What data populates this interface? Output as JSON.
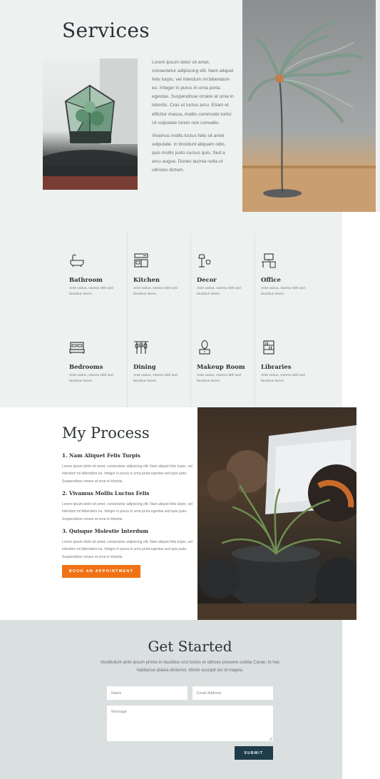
{
  "services": {
    "title": "Services",
    "paragraph1": "Lorem ipsum dolor sit amet, consectetur adipiscing elit. Nam aliquet felis turpis, vel interdum mi bibendum eu. Integer in purus in urna porta egestas. Suspendisse ornare at urna in lobortis. Cras ut luctus arcu. Etiam et efficitur massa, mattis commodo tortor. Ut vulputate lorem non convallis.",
    "paragraph2": "Vivamus mollis luctus felis sit amet vulputate. In tincidunt aliquam odio, quis mollis justo cursus quis. Sed a arcu augue. Donec lacinia nulla ut ultricies dictum."
  },
  "rooms": [
    {
      "name": "Bathroom",
      "icon": "bathtub-icon",
      "desc": "Ante varius, viverra nibh sed faucibus lorem."
    },
    {
      "name": "Kitchen",
      "icon": "kitchen-icon",
      "desc": "Ante varius, viverra nibh sed faucibus lorem."
    },
    {
      "name": "Decor",
      "icon": "lamp-icon",
      "desc": "Ante varius, viverra nibh sed faucibus lorem."
    },
    {
      "name": "Office",
      "icon": "desk-icon",
      "desc": "Ante varius, viverra nibh sed faucibus lorem."
    },
    {
      "name": "Bedrooms",
      "icon": "bed-icon",
      "desc": "Ante varius, viverra nibh sed faucibus lorem."
    },
    {
      "name": "Dining",
      "icon": "utensils-icon",
      "desc": "Ante varius, viverra nibh sed faucibus lorem."
    },
    {
      "name": "Makeup Room",
      "icon": "mirror-icon",
      "desc": "Ante varius, viverra nibh sed faucibus lorem."
    },
    {
      "name": "Libraries",
      "icon": "bookshelf-icon",
      "desc": "Ante varius, viverra nibh sed faucibus lorem."
    }
  ],
  "process": {
    "title": "My Process",
    "steps": [
      {
        "title": "1. Nam Aliquet Felis Turpis",
        "text": "Lorem ipsum dolor sit amet, consectetur adipiscing elit. Nam aliquet felis turpis, vel interdum mi bibendum eu. Integer in purus in urna porta egestas sed quis justo. Suspendisse ornare at urna in lobortis."
      },
      {
        "title": "2. Vivamus Mollis Luctus Felis",
        "text": "Lorem ipsum dolor sit amet, consectetur adipiscing elit. Nam aliquet felis turpis, vel interdum mi bibendum eu. Integer in purus in urna porta egestas sed quis justo. Suspendisse ornare at urna in lobortis."
      },
      {
        "title": "3. Quisque Molestie Interdum",
        "text": "Lorem ipsum dolor sit amet, consectetur adipiscing elit. Nam aliquet felis turpis, vel interdum mi bibendum eu. Integer in purus in urna porta egestas sed quis justo. Suspendisse ornare at urna in lobortis."
      }
    ],
    "button_label": "BOOK AN APPOINTMENT"
  },
  "get_started": {
    "title": "Get Started",
    "text": "Vestibulum ante ipsum primis in faucibus orci luctus et ultrices posuere cubilia Curae; In hac habitasse platea dictumst. Morbi suscipit dui id magna.",
    "name_placeholder": "Name",
    "email_placeholder": "Email Address",
    "message_placeholder": "Message",
    "submit_label": "SUBMIT"
  },
  "colors": {
    "accent_orange": "#f07214",
    "submit_navy": "#1f3c4a",
    "section_bg_light": "#edf1f0",
    "section_bg_gray": "#dadfe0",
    "heading": "#2c3236"
  }
}
